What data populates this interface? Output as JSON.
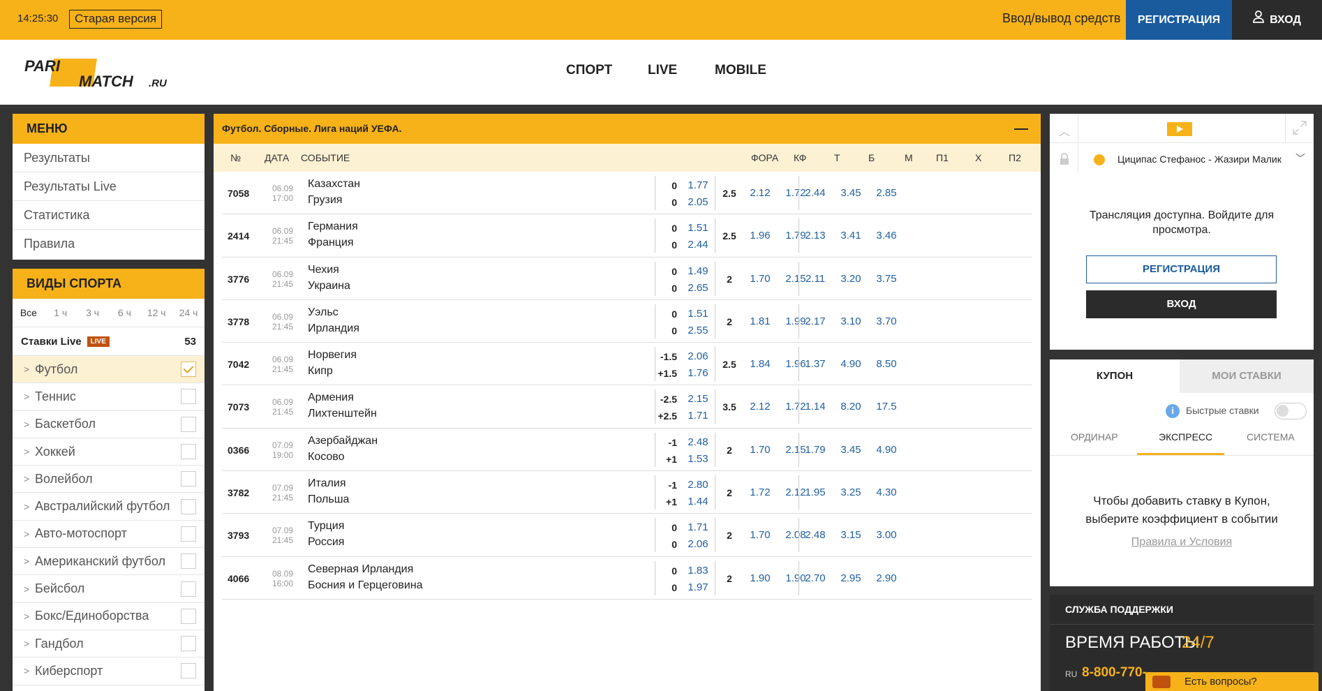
{
  "topbar": {
    "time": "14:25:30",
    "old_version": "Старая версия",
    "funds": "Ввод/вывод средств",
    "register": "РЕГИСТРАЦИЯ",
    "login": "ВХОД"
  },
  "header": {
    "logo_pari": "PARI",
    "logo_match": "MATCH",
    "logo_ru": ".RU",
    "nav": [
      "СПОРТ",
      "LIVE",
      "MOBILE"
    ]
  },
  "menu": {
    "title": "МЕНЮ",
    "items": [
      "Результаты",
      "Результаты Live",
      "Статистика",
      "Правила"
    ]
  },
  "sports": {
    "title": "ВИДЫ СПОРТА",
    "filters": [
      "Все",
      "1 ч",
      "3 ч",
      "6 ч",
      "12 ч",
      "24 ч"
    ],
    "live_label": "Ставки Live",
    "live_badge": "LIVE",
    "live_count": "53",
    "items": [
      {
        "name": "Футбол",
        "checked": true
      },
      {
        "name": "Теннис",
        "checked": false
      },
      {
        "name": "Баскетбол",
        "checked": false
      },
      {
        "name": "Хоккей",
        "checked": false
      },
      {
        "name": "Волейбол",
        "checked": false
      },
      {
        "name": "Австралийский футбол",
        "checked": false
      },
      {
        "name": "Авто-мотоспорт",
        "checked": false
      },
      {
        "name": "Американский футбол",
        "checked": false
      },
      {
        "name": "Бейсбол",
        "checked": false
      },
      {
        "name": "Бокс/Единоборства",
        "checked": false
      },
      {
        "name": "Гандбол",
        "checked": false
      },
      {
        "name": "Киберспорт",
        "checked": false
      }
    ]
  },
  "main": {
    "title": "Футбол. Сборные. Лига наций УЕФА.",
    "columns": {
      "num": "№",
      "date": "ДАТА",
      "event": "СОБЫТИЕ",
      "fora": "ФОРА",
      "kf": "КФ",
      "t": "Т",
      "b": "Б",
      "m": "М",
      "p1": "П1",
      "x": "Х",
      "p2": "П2"
    },
    "events": [
      {
        "num": "7058",
        "date": "06.09",
        "time": "17:00",
        "team1": "Казахстан",
        "team2": "Грузия",
        "h1": "0",
        "h2": "0",
        "k1": "1.77",
        "k2": "2.05",
        "total": "2.5",
        "over": "2.12",
        "under": "1.72",
        "p1": "2.44",
        "x": "3.45",
        "p2": "2.85"
      },
      {
        "num": "2414",
        "date": "06.09",
        "time": "21:45",
        "team1": "Германия",
        "team2": "Франция",
        "h1": "0",
        "h2": "0",
        "k1": "1.51",
        "k2": "2.44",
        "total": "2.5",
        "over": "1.96",
        "under": "1.79",
        "p1": "2.13",
        "x": "3.41",
        "p2": "3.46"
      },
      {
        "num": "3776",
        "date": "06.09",
        "time": "21:45",
        "team1": "Чехия",
        "team2": "Украина",
        "h1": "0",
        "h2": "0",
        "k1": "1.49",
        "k2": "2.65",
        "total": "2",
        "over": "1.70",
        "under": "2.15",
        "p1": "2.11",
        "x": "3.20",
        "p2": "3.75"
      },
      {
        "num": "3778",
        "date": "06.09",
        "time": "21:45",
        "team1": "Уэльс",
        "team2": "Ирландия",
        "h1": "0",
        "h2": "0",
        "k1": "1.51",
        "k2": "2.55",
        "total": "2",
        "over": "1.81",
        "under": "1.99",
        "p1": "2.17",
        "x": "3.10",
        "p2": "3.70"
      },
      {
        "num": "7042",
        "date": "06.09",
        "time": "21:45",
        "team1": "Норвегия",
        "team2": "Кипр",
        "h1": "-1.5",
        "h2": "+1.5",
        "k1": "2.06",
        "k2": "1.76",
        "total": "2.5",
        "over": "1.84",
        "under": "1.96",
        "p1": "1.37",
        "x": "4.90",
        "p2": "8.50"
      },
      {
        "num": "7073",
        "date": "06.09",
        "time": "21:45",
        "team1": "Армения",
        "team2": "Лихтенштейн",
        "h1": "-2.5",
        "h2": "+2.5",
        "k1": "2.15",
        "k2": "1.71",
        "total": "3.5",
        "over": "2.12",
        "under": "1.72",
        "p1": "1.14",
        "x": "8.20",
        "p2": "17.5"
      },
      {
        "num": "0366",
        "date": "07.09",
        "time": "19:00",
        "team1": "Азербайджан",
        "team2": "Косово",
        "h1": "-1",
        "h2": "+1",
        "k1": "2.48",
        "k2": "1.53",
        "total": "2",
        "over": "1.70",
        "under": "2.15",
        "p1": "1.79",
        "x": "3.45",
        "p2": "4.90"
      },
      {
        "num": "3782",
        "date": "07.09",
        "time": "21:45",
        "team1": "Италия",
        "team2": "Польша",
        "h1": "-1",
        "h2": "+1",
        "k1": "2.80",
        "k2": "1.44",
        "total": "2",
        "over": "1.72",
        "under": "2.12",
        "p1": "1.95",
        "x": "3.25",
        "p2": "4.30"
      },
      {
        "num": "3793",
        "date": "07.09",
        "time": "21:45",
        "team1": "Турция",
        "team2": "Россия",
        "h1": "0",
        "h2": "0",
        "k1": "1.71",
        "k2": "2.06",
        "total": "2",
        "over": "1.70",
        "under": "2.08",
        "p1": "2.48",
        "x": "3.15",
        "p2": "3.00"
      },
      {
        "num": "4066",
        "date": "08.09",
        "time": "16:00",
        "team1": "Северная Ирландия",
        "team2": "Босния и Герцеговина",
        "h1": "0",
        "h2": "0",
        "k1": "1.83",
        "k2": "1.97",
        "total": "2",
        "over": "1.90",
        "under": "1.90",
        "p1": "2.70",
        "x": "2.95",
        "p2": "2.90"
      }
    ]
  },
  "stream": {
    "match": "Циципас Стефанос - Жазири Малик",
    "message": "Трансляция доступна. Войдите для просмотра.",
    "register": "РЕГИСТРАЦИЯ",
    "login": "ВХОД"
  },
  "coupon": {
    "tab_coupon": "КУПОН",
    "tab_mybets": "МОИ СТАВКИ",
    "quick_bets": "Быстрые ставки",
    "types": [
      "ОРДИНАР",
      "ЭКСПРЕСС",
      "СИСТЕМА"
    ],
    "message": "Чтобы добавить ставку в Купон, выберите коэффициент в событии",
    "rules_link": "Правила и Условия"
  },
  "support": {
    "title": "СЛУЖБА ПОДДЕРЖКИ",
    "hours_label": "ВРЕМЯ РАБОТЫ",
    "hours_value": "24/7",
    "phone_prefix": "RU",
    "phone": "8-800-770-",
    "chat": "Есть вопросы?"
  },
  "colors": {
    "accent": "#f7b219",
    "brand_blue": "#1a5b9e",
    "dark": "#2b2b2b",
    "odds": "#1f5fa4",
    "live_badge": "#c0520f"
  }
}
